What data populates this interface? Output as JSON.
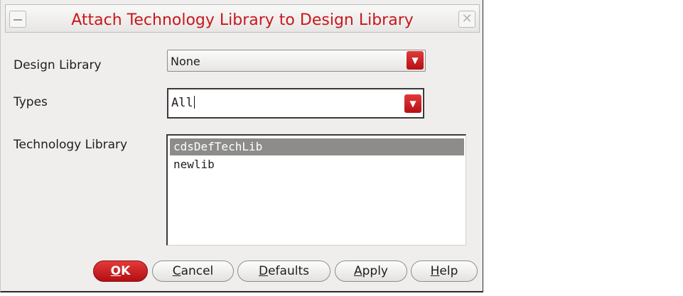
{
  "dialog": {
    "title": "Attach Technology Library to Design Library",
    "title_color": "#c8181d",
    "accent_color": "#c8181d",
    "icons": {
      "minimize": "minimize-icon",
      "close": "close-icon",
      "dropdown": "chevron-down-icon"
    }
  },
  "fields": {
    "design_library": {
      "label": "Design Library",
      "value": "None"
    },
    "types": {
      "label": "Types",
      "value": "All"
    },
    "technology_library": {
      "label": "Technology Library",
      "items": [
        {
          "text": "cdsDefTechLib",
          "selected": true
        },
        {
          "text": "newlib",
          "selected": false
        }
      ]
    }
  },
  "buttons": {
    "ok": {
      "mnemonic": "O",
      "rest": "K"
    },
    "cancel": {
      "mnemonic": "C",
      "rest": "ancel"
    },
    "defaults": {
      "mnemonic": "D",
      "rest": "efaults"
    },
    "apply": {
      "mnemonic": "A",
      "rest": "pply"
    },
    "help": {
      "mnemonic": "H",
      "rest": "elp"
    }
  }
}
